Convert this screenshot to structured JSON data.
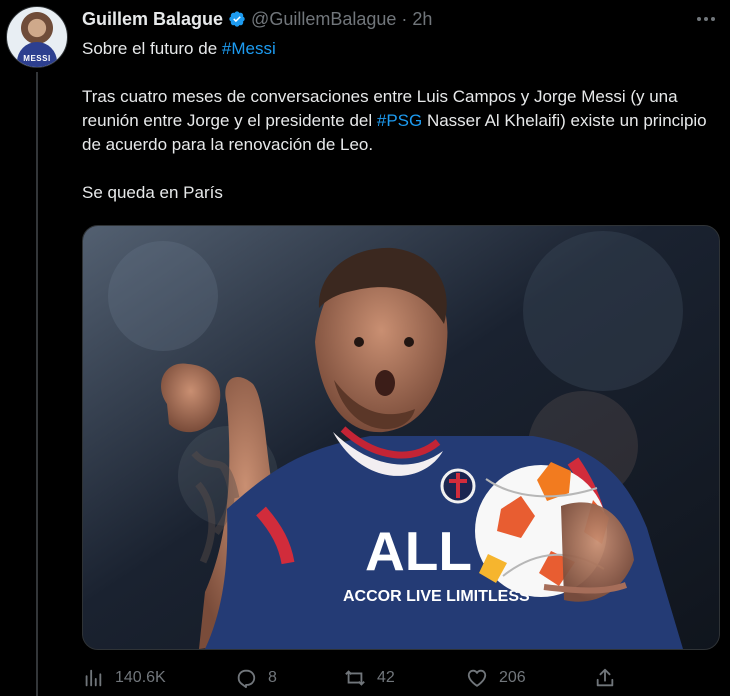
{
  "tweet": {
    "display_name": "Guillem Balague",
    "handle": "@GuillemBalague",
    "separator": "·",
    "time": "2h",
    "avatar_text": "MESSI",
    "line1_prefix": "Sobre el futuro de ",
    "line1_hashtag": "#Messi",
    "paragraph_part1": "Tras cuatro meses de conversaciones entre Luis Campos y Jorge Messi (y una reunión entre Jorge y el presidente del ",
    "paragraph_hashtag": "#PSG",
    "paragraph_part2": " Nasser Al Khelaifi) existe un principio de acuerdo para la renovación de Leo.",
    "closing": "Se queda en París",
    "image_caption_visible": "ALL ACCOR LIVE LIMITLESS"
  },
  "icons": {
    "verified": "verified-badge-icon",
    "more": "more-options-icon",
    "views": "views-icon",
    "reply": "reply-icon",
    "retweet": "retweet-icon",
    "like": "like-icon",
    "share": "share-icon"
  },
  "stats": {
    "views": "140.6K",
    "replies": "8",
    "retweets": "42",
    "likes": "206"
  },
  "colors": {
    "background": "#000000",
    "primary_text": "#e7e9ea",
    "secondary_text": "#71767b",
    "accent": "#1d9bf0",
    "border": "#2f3336"
  }
}
